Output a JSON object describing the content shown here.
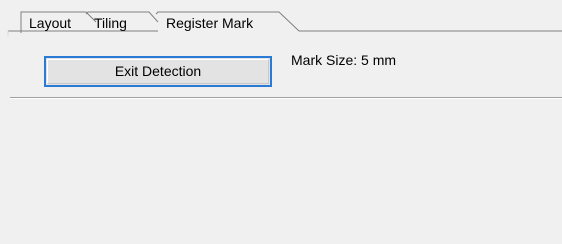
{
  "tabs": [
    {
      "label": "Layout",
      "active": false
    },
    {
      "label": "Tiling",
      "active": false
    },
    {
      "label": "Register Mark",
      "active": true
    }
  ],
  "register_mark": {
    "exit_button_label": "Exit Detection",
    "mark_size_label": "Mark Size:",
    "mark_size_value": "5 mm"
  },
  "colors": {
    "background": "#f0f0f0",
    "focus_border": "#2a7ad6",
    "button_face": "#e3e3e3",
    "tab_outline": "#808080"
  }
}
